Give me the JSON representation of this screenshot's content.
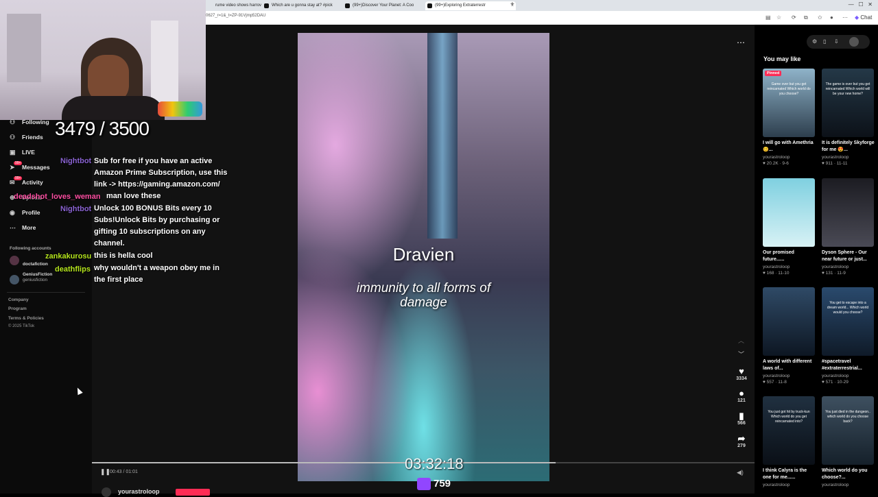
{
  "browser": {
    "tabs": [
      {
        "label": "rume video shows harrov"
      },
      {
        "label": "Which are u gonna stay at? #pick"
      },
      {
        "label": "(99+)Discover Your Planet: A Coo"
      },
      {
        "label": "(99+)Exploring Extraterrestr"
      }
    ],
    "new_tab_icon": "plus-icon",
    "url": "0627_r=1&_t=ZP-91Vjmp52DAU",
    "chat_button": "Chat"
  },
  "sidebar": {
    "items": [
      {
        "label": "Following",
        "icon": "following-icon"
      },
      {
        "label": "Friends",
        "icon": "friends-icon"
      },
      {
        "label": "LIVE",
        "icon": "live-icon"
      },
      {
        "label": "Messages",
        "icon": "messages-icon",
        "badge": "99+"
      },
      {
        "label": "Activity",
        "icon": "activity-icon",
        "badge": "99+"
      },
      {
        "label": "Upload",
        "icon": "upload-icon"
      },
      {
        "label": "Profile",
        "icon": "profile-icon"
      },
      {
        "label": "More",
        "icon": "more-icon"
      }
    ],
    "following_header": "Following accounts",
    "accounts": [
      {
        "name": "doctafiction"
      },
      {
        "name": "GeniusFiction",
        "handle": "geniusfiction"
      }
    ],
    "footer": [
      "Company",
      "Program",
      "Terms & Policies",
      "© 2025 TikTok"
    ]
  },
  "overlay": {
    "counter": "3479 / 3500",
    "chat_users": [
      {
        "name": "Nightbot",
        "color": "#8a63d2"
      },
      {
        "name": "deadshot_loves_weman",
        "color": "#ff4fa3"
      },
      {
        "name": "Nightbot",
        "color": "#8a63d2"
      },
      {
        "name": "zankakurosu",
        "color": "#b5e61d"
      },
      {
        "name": "deathflips",
        "color": "#b5e61d"
      }
    ],
    "chat_lines": [
      "Sub for free if you have an active Amazon Prime Subscription, use this link -> https://gaming.amazon.com/",
      "man love these",
      "Unlock 100 BONUS Bits every 10 Subs!Unlock Bits by purchasing or gifting 10 subscriptions on any channel.",
      "this is hella cool",
      "why wouldn't a weapon obey me in the first place"
    ],
    "stream_time": "03:32:18",
    "viewer_count": "759"
  },
  "video": {
    "title_text": "Dravien",
    "subtitle_text": "immunity to all forms of damage",
    "time": "00:43 / 01:01",
    "progress": 0.7,
    "author": "yourastroloop",
    "actions": [
      {
        "icon": "heart-icon",
        "count": "3334"
      },
      {
        "icon": "comment-icon",
        "count": "121"
      },
      {
        "icon": "bookmark-icon",
        "count": "566"
      },
      {
        "icon": "share-icon",
        "count": "279"
      }
    ]
  },
  "recommendations": {
    "title": "You may like",
    "cards": [
      {
        "title": "I will go with Amethria 😊...",
        "author": "yourastroloop",
        "stats": "♥ 20.2K · 9-6",
        "pinned": "Pinned",
        "thumb_text": "Game over but you get reincarnated Which world do you choose?",
        "color1": "#8fb3c9",
        "color2": "#2d3e4d"
      },
      {
        "title": "It is definitely Skyforge for me 😍...",
        "author": "yourastroloop",
        "stats": "♥ 911 · 11-11",
        "pinned": "",
        "thumb_text": "The game is over but you get reincarnated Which world will be your new home?",
        "color1": "#243847",
        "color2": "#0c1118"
      },
      {
        "title": "Our promised future......",
        "author": "yourastroloop",
        "stats": "♥ 168 · 11-10",
        "pinned": "",
        "thumb_text": "",
        "color1": "#7fd0e0",
        "color2": "#d8f2f5"
      },
      {
        "title": "Dyson Sphere - Our near future or just...",
        "author": "yourastroloop",
        "stats": "♥ 131 · 11-9",
        "pinned": "",
        "thumb_text": "",
        "color1": "#1c1c22",
        "color2": "#4a4a55"
      },
      {
        "title": "A world with different laws of...",
        "author": "yourastroloop",
        "stats": "♥ 557 · 11-8",
        "pinned": "",
        "thumb_text": "",
        "color1": "#2f4a66",
        "color2": "#0d1622"
      },
      {
        "title": "#spacetravel #extraterrestrial...",
        "author": "yourastroloop",
        "stats": "♥ 571 · 10-29",
        "pinned": "",
        "thumb_text": "You get to escape into a dream world... Which world would you choose?",
        "color1": "#2a4a6d",
        "color2": "#0f1a28"
      },
      {
        "title": "I think Calyra is the one for me......",
        "author": "yourastroloop",
        "stats": "",
        "pinned": "",
        "thumb_text": "You just got hit by truck-kun Which world do you get reincarnated into?",
        "color1": "#203040",
        "color2": "#0a0f16"
      },
      {
        "title": "Which world do you choose?...",
        "author": "yourastroloop",
        "stats": "",
        "pinned": "",
        "thumb_text": "You just died in the dungeon.. which world do you choose back?",
        "color1": "#3e5060",
        "color2": "#15202a"
      }
    ]
  },
  "colors": {
    "accent": "#fe2c55",
    "background": "#121212"
  }
}
